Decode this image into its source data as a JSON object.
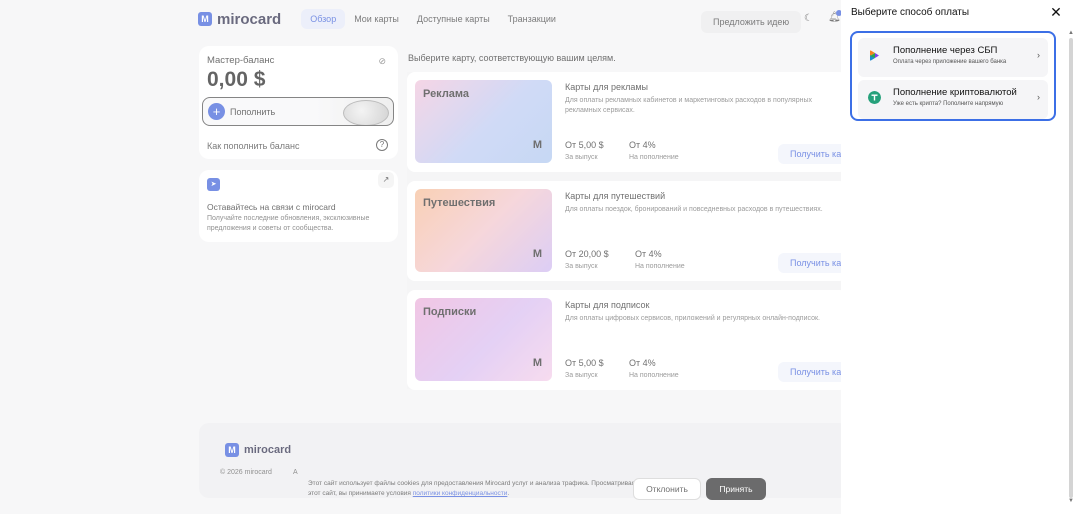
{
  "header": {
    "logo": "mirocard",
    "nav": [
      "Обзор",
      "Мои карты",
      "Доступные карты",
      "Транзакции"
    ],
    "idea_button": "Предложить идею"
  },
  "balance": {
    "title": "Мастер-баланс",
    "value": "0,00 $",
    "topup_label": "Пополнить",
    "howto_label": "Как пополнить баланс"
  },
  "telegram": {
    "title": "Оставайтесь на связи с mirocard",
    "description": "Получайте последние обновления, эксклюзивные предложения и советы от сообщества."
  },
  "offers": {
    "heading": "Выберите карту, соответствующую вашим целям.",
    "items": [
      {
        "image_label": "Реклама",
        "title": "Карты для рекламы",
        "description": "Для оплаты рекламных кабинетов и маркетинговых расходов в популярных рекламных сервисах.",
        "price": "От 5,00 $",
        "price_sub": "За выпуск",
        "pct": "От 4%",
        "pct_sub": "На пополнение",
        "button": "Получить карту"
      },
      {
        "image_label": "Путешествия",
        "title": "Карты для путешествий",
        "description": "Для оплаты поездок, бронирований и повседневных расходов в путешествиях.",
        "price": "От 20,00 $",
        "price_sub": "За выпуск",
        "pct": "От 4%",
        "pct_sub": "На пополнение",
        "button": "Получить карту"
      },
      {
        "image_label": "Подписки",
        "title": "Карты для подписок",
        "description": "Для оплаты цифровых сервисов, приложений и регулярных онлайн-подписок.",
        "price": "От 5,00 $",
        "price_sub": "За выпуск",
        "pct": "От 4%",
        "pct_sub": "На пополнение",
        "button": "Получить карту"
      }
    ]
  },
  "footer": {
    "logo": "mirocard",
    "copyright": "© 2026 mirocard",
    "extra": "A"
  },
  "cookie": {
    "text": "Этот сайт использует файлы cookies для предоставления Mirocard услуг и анализа трафика. Просматривая этот сайт, вы принимаете условия",
    "link": "политики конфиденциальности",
    "decline": "Отклонить",
    "accept": "Принять"
  },
  "drawer": {
    "title": "Выберите способ оплаты",
    "methods": [
      {
        "title": "Пополнение через СБП",
        "description": "Оплата через приложение вашего банка",
        "icon": "sbp-icon",
        "color": "#7b3ff2"
      },
      {
        "title": "Пополнение криптовалютой",
        "description": "Уже есть крипта? Пополните напрямую",
        "icon": "tether-icon",
        "color": "#26a17b"
      }
    ]
  },
  "colors": {
    "accent": "#3155d6",
    "selection_border": "#3c6fe6"
  }
}
